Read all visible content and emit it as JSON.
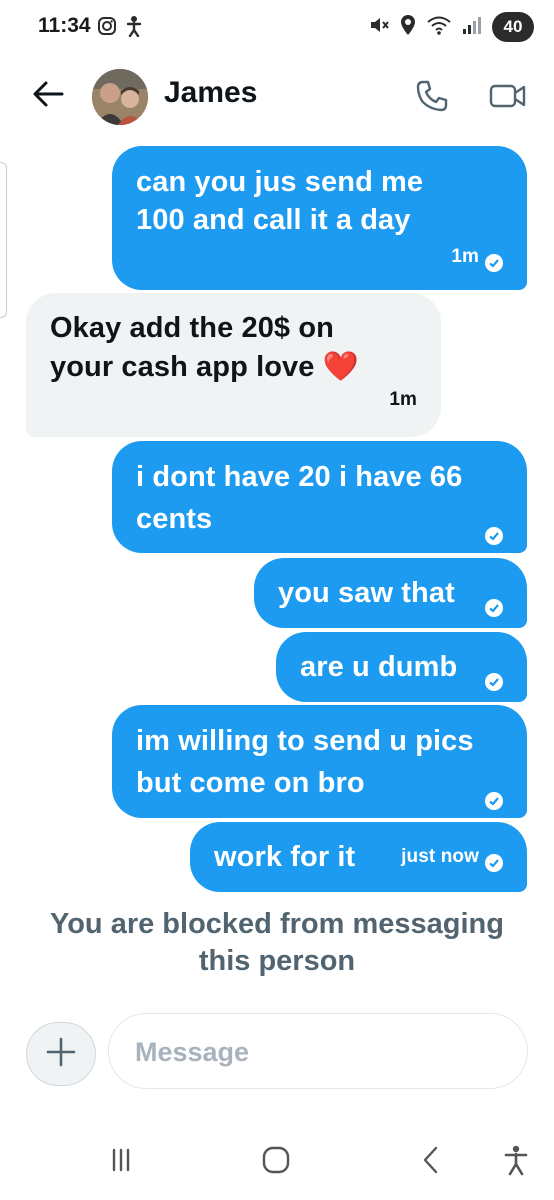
{
  "status_bar": {
    "time": "11:34",
    "left_icons": [
      "instagram-icon",
      "accessibility-person-icon"
    ],
    "right_icons": [
      "mute-icon",
      "location-icon",
      "wifi-icon",
      "signal-icon"
    ],
    "battery": "40"
  },
  "header": {
    "contact_name": "James",
    "icons": [
      "back-arrow-icon",
      "phone-icon",
      "video-camera-icon"
    ]
  },
  "messages": [
    {
      "direction": "outgoing",
      "lines": [
        "can you jus send me",
        "100 and call it a day"
      ],
      "time": "1m",
      "read": true
    },
    {
      "direction": "incoming",
      "lines": [
        "Okay add the 20$ on",
        "your cash app love ❤️"
      ],
      "time": "1m"
    },
    {
      "direction": "outgoing",
      "lines": [
        "i dont have 20 i have 66",
        "cents"
      ],
      "time": "",
      "read": true
    },
    {
      "direction": "outgoing",
      "lines": [
        "you saw that"
      ],
      "time": "",
      "read": true
    },
    {
      "direction": "outgoing",
      "lines": [
        "are u dumb"
      ],
      "time": "",
      "read": true
    },
    {
      "direction": "outgoing",
      "lines": [
        "im willing to send u pics",
        "but come on bro"
      ],
      "time": "",
      "read": true
    },
    {
      "direction": "outgoing",
      "lines": [
        "work for it"
      ],
      "time": "just now",
      "read": true
    }
  ],
  "blocked_notice": [
    "You are blocked from messaging",
    "this person"
  ],
  "composer": {
    "placeholder": "Message",
    "value": ""
  },
  "nav_bar": [
    "recent-apps-icon",
    "home-icon",
    "back-icon",
    "accessibility-icon"
  ],
  "colors": {
    "outgoing_bubble": "#1d9bf0",
    "incoming_bubble": "#eff3f4",
    "muted_text": "#536471"
  }
}
